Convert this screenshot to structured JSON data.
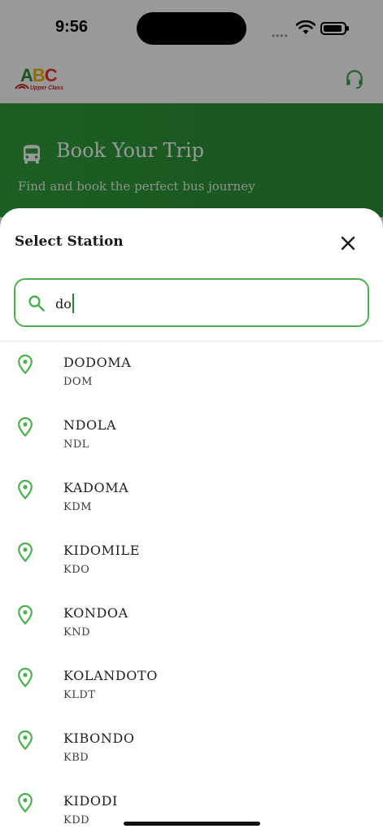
{
  "status_bar": {
    "time": "9:56",
    "signal_dots": "••••"
  },
  "brand": {
    "logo_letters": [
      "A",
      "B",
      "C"
    ],
    "logo_tagline": "Upper Class",
    "accent_color": "#4caf50"
  },
  "hero": {
    "title": "Book Your Trip",
    "subtitle": "Find and book the perfect bus journey"
  },
  "sheet": {
    "title": "Select Station",
    "search": {
      "value": "do"
    },
    "stations": [
      {
        "name": "DODOMA",
        "code": "DOM"
      },
      {
        "name": "NDOLA",
        "code": "NDL"
      },
      {
        "name": "KADOMA",
        "code": "KDM"
      },
      {
        "name": "KIDOMILE",
        "code": "KDO"
      },
      {
        "name": "KONDOA",
        "code": "KND"
      },
      {
        "name": "KOLANDOTO",
        "code": "KLDT"
      },
      {
        "name": "KIBONDO",
        "code": "KBD"
      },
      {
        "name": "KIDODI",
        "code": "KDD"
      }
    ]
  },
  "icons": {
    "close": "close-icon",
    "search": "search-icon",
    "station": "location-pin-icon",
    "support": "headset-icon",
    "bus": "bus-icon"
  }
}
